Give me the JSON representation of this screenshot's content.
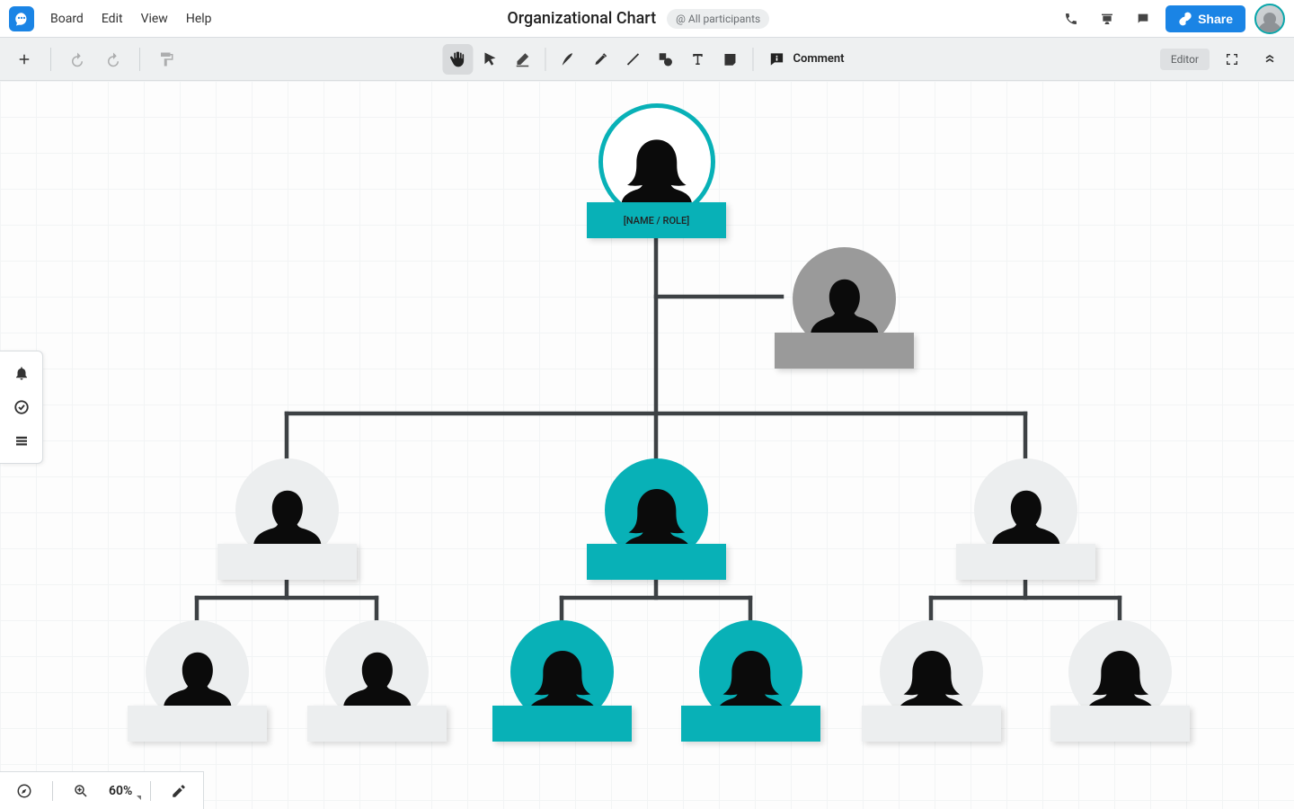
{
  "menubar": {
    "items": [
      "Board",
      "Edit",
      "View",
      "Help"
    ],
    "doc_title": "Organizational Chart",
    "participants_pill": "@ All participants",
    "share_label": "Share"
  },
  "toolbar": {
    "comment_label": "Comment",
    "editor_label": "Editor"
  },
  "canvas": {
    "root_label": "[NAME / ROLE]"
  },
  "bottom": {
    "zoom": "60%"
  },
  "colors": {
    "teal": "#08b1b7",
    "gray_node": "#9a9a9a",
    "light_node": "#eceeef",
    "blue": "#1a84e5"
  },
  "chart_data": {
    "type": "org-chart",
    "root": {
      "id": "root",
      "gender": "female",
      "variant": "teal-outline",
      "label": "[NAME / ROLE]",
      "assistant": {
        "id": "assistant",
        "gender": "male",
        "variant": "gray",
        "label": ""
      },
      "children": [
        {
          "id": "c1",
          "gender": "male",
          "variant": "light",
          "label": "",
          "children": [
            {
              "id": "c1a",
              "gender": "male",
              "variant": "light",
              "label": ""
            },
            {
              "id": "c1b",
              "gender": "male",
              "variant": "light",
              "label": ""
            }
          ]
        },
        {
          "id": "c2",
          "gender": "female",
          "variant": "teal",
          "label": "",
          "children": [
            {
              "id": "c2a",
              "gender": "female",
              "variant": "teal",
              "label": ""
            },
            {
              "id": "c2b",
              "gender": "female",
              "variant": "teal",
              "label": ""
            }
          ]
        },
        {
          "id": "c3",
          "gender": "male",
          "variant": "light",
          "label": "",
          "children": [
            {
              "id": "c3a",
              "gender": "female",
              "variant": "light",
              "label": ""
            },
            {
              "id": "c3b",
              "gender": "female",
              "variant": "light",
              "label": ""
            }
          ]
        }
      ]
    }
  }
}
